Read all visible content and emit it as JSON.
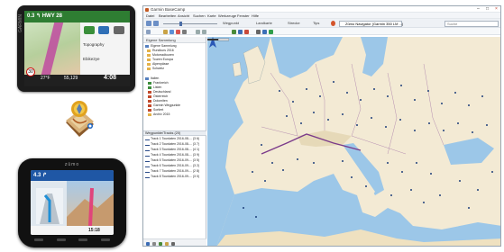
{
  "device1": {
    "road": "HWY 28",
    "distance": "0.3",
    "menu_topography": "Topography",
    "menu_ebike": "Ebike2ye",
    "speed_limit": "30",
    "temp": "27°F",
    "elevation": "55,129",
    "time": "4:08",
    "brand": "GARMIN"
  },
  "device2": {
    "logo": "zūmo",
    "distance": "4.3",
    "time": "15:18"
  },
  "basecamp": {
    "title": "Garmin BaseCamp",
    "menu": [
      "Datei",
      "Bearbeiten",
      "Ansicht",
      "Suchen",
      "Karte",
      "Werkzeuge",
      "Fenster",
      "Hilfe"
    ],
    "device_select": "Zūmo Navigator (Garmin 350 LM ...)",
    "search_placeholder": "Suche",
    "library_header": "Eigene Sammlung",
    "tree_items": [
      "Eigene Sammlung",
      "Rundkurs 2016",
      "Motorradtouren",
      "Touren Europa",
      "Alpenpässe",
      "Schweiz",
      "Italien",
      "Frankreich",
      "Listen",
      "Deutschland",
      "Österreich",
      "Dolomiten",
      "Garmin Wegpunkte",
      "Sortiert",
      "Archiv 2015"
    ],
    "list_header": "Wegpunkte/Tracks (20)",
    "list_items": [
      "Track 1  Tourdaten 2016-08-... (3 6)",
      "Track 2  Tourdaten 2016-08-... (3 7)",
      "Track 3  Tourdaten 2016-08-... (4 1)",
      "Track 4  Tourdaten 2016-08-... (3 9)",
      "Track 5  Tourdaten 2016-09-... (3 5)",
      "Track 6  Tourdaten 2016-09-... (3 2)",
      "Track 7  Tourdaten 2016-09-... (2 8)",
      "Track 8  Tourdaten 2016-09-... (3 0)"
    ],
    "toolbar": {
      "label_1": "Wegpunkt",
      "label_2": "Landkarte",
      "label_3": "Strecke",
      "label_4": "Tips"
    },
    "window_controls": [
      "–",
      "□",
      "×"
    ],
    "colors": {
      "accent": "#2f6fb6",
      "sea": "#9cc7e8",
      "land": "#f5ecd8",
      "route": "#7a3a8a",
      "city": "#1e3f7a"
    }
  }
}
